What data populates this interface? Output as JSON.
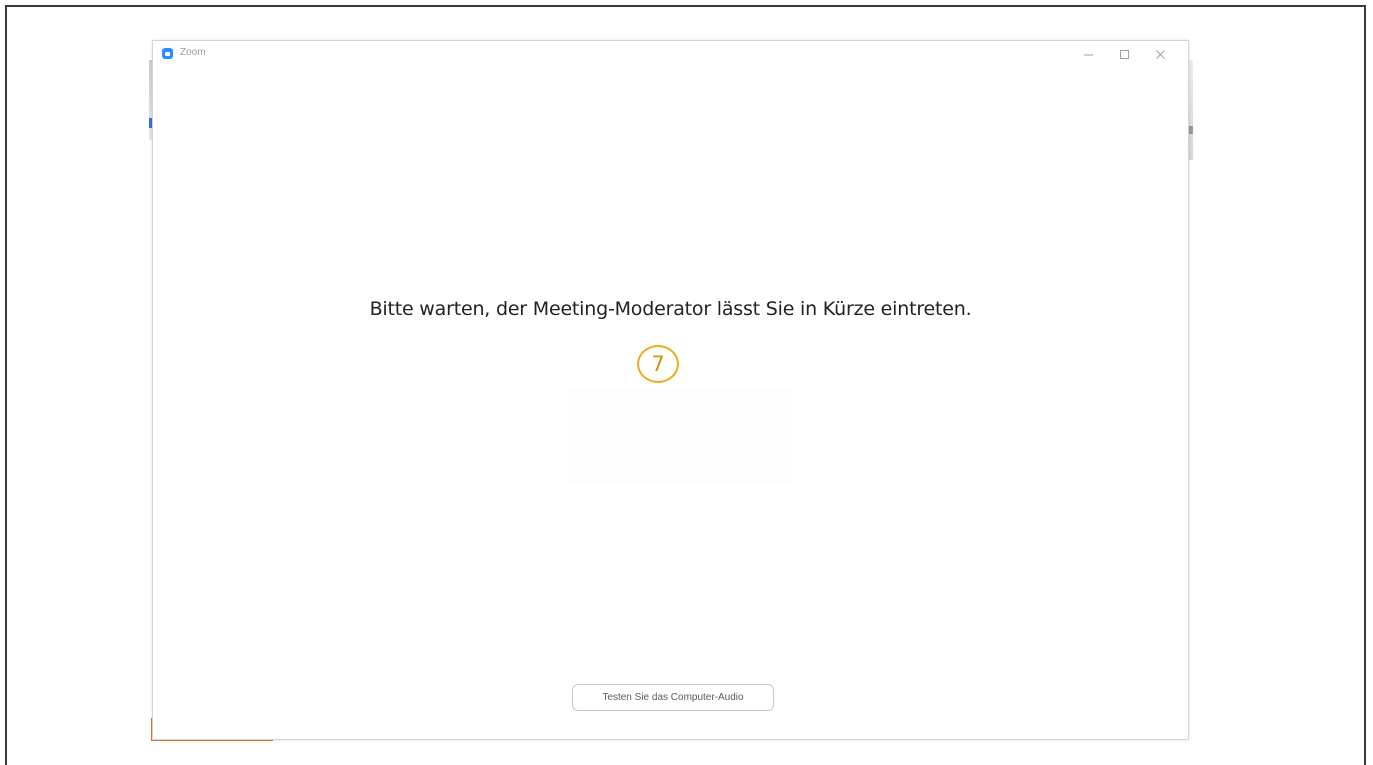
{
  "window": {
    "title": "Zoom",
    "controls": {
      "minimize_icon": "minimize-icon",
      "maximize_icon": "maximize-icon",
      "close_icon": "close-icon"
    }
  },
  "waiting_room": {
    "message": "Bitte warten, der Meeting-Moderator lässt Sie in Kürze eintreten.",
    "step_number": "7",
    "test_audio_button": "Testen Sie das Computer-Audio"
  },
  "colors": {
    "accent_blue": "#2d8cff",
    "step_badge": "#f0a81c",
    "taskbar_orange": "#e07a2f"
  }
}
